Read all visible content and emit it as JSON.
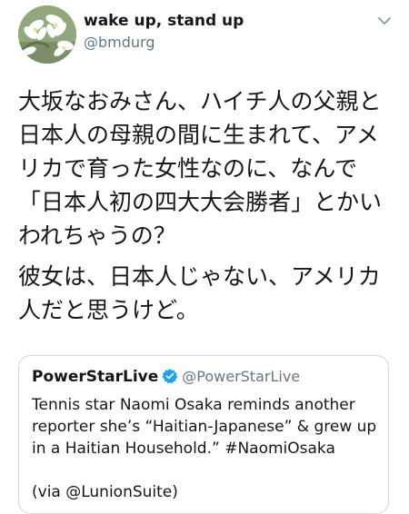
{
  "tweet": {
    "author": {
      "display_name": "wake up, stand up",
      "handle": "@bmdurg",
      "avatar_icon": "white-flowers-avatar"
    },
    "menu_icon": "chevron-down-icon",
    "paragraphs": [
      "大坂なおみさん、ハイチ人の父親と日本人の母親の間に生まれて、アメリカで育った女性なのに、なんで「日本人初の四大大会勝者」とかいわれちゃうの？",
      "彼女は、日本人じゃない、アメリカ人だと思うけど。"
    ]
  },
  "quoted_tweet": {
    "author_name": "PowerStarLive",
    "verified": true,
    "handle": "@PowerStarLive",
    "paragraphs": [
      "Tennis star Naomi Osaka reminds another reporter she’s “Haitian-Japanese” & grew up in a Haitian Household.” #NaomiOsaka",
      "(via @LunionSuite)"
    ]
  },
  "colors": {
    "text": "#14171a",
    "secondary": "#657786",
    "border": "#ccd6dd",
    "verified_blue": "#1da1f2"
  }
}
